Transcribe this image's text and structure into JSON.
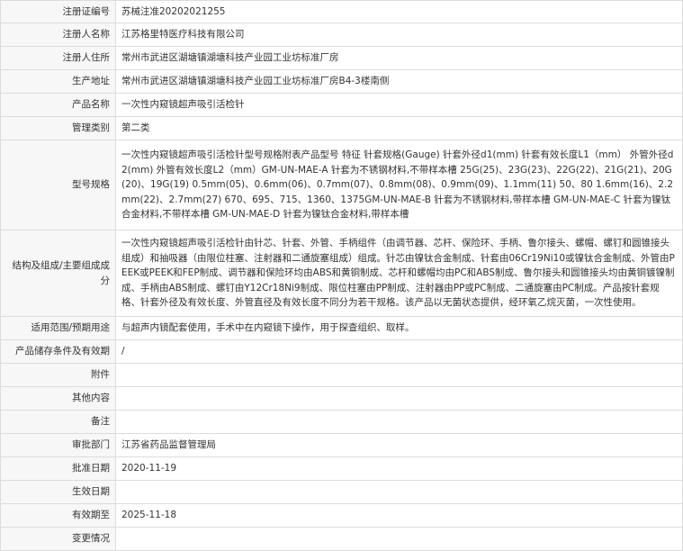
{
  "rows": [
    {
      "label": "注册证编号",
      "value": "苏械注准20202021255"
    },
    {
      "label": "注册人名称",
      "value": "江苏格里特医疗科技有限公司"
    },
    {
      "label": "注册人住所",
      "value": "常州市武进区湖塘镇湖塘科技产业园工业坊标准厂房"
    },
    {
      "label": "生产地址",
      "value": "常州市武进区湖塘镇湖塘科技产业园工业坊标准厂房B4-3楼南侧"
    },
    {
      "label": "产品名称",
      "value": "一次性内窥镜超声吸引活检针"
    },
    {
      "label": "管理类别",
      "value": "第二类"
    },
    {
      "label": "型号规格",
      "value": "一次性内窥镜超声吸引活检针型号规格附表产品型号 特征 针套规格(Gauge) 针套外径d1(mm) 针套有效长度L1（mm） 外管外径d2(mm) 外管有效长度L2（mm）GM-UN-MAE-A 针套为不锈钢材料,不带样本槽 25G(25)、23G(23)、22G(22)、21G(21)、20G(20)、19G(19) 0.5mm(05)、0.6mm(06)、0.7mm(07)、0.8mm(08)、0.9mm(09)、1.1mm(11) 50、80 1.6mm(16)、2.2mm(22)、2.7mm(27) 670、695、715、1360、1375GM-UN-MAE-B 针套为不锈钢材料,带样本槽 GM-UN-MAE-C 针套为镍钛合金材料,不带样本槽 GM-UN-MAE-D 针套为镍钛合金材料,带样本槽"
    },
    {
      "label": "结构及组成/主要组成成分",
      "value": "一次性内窥镜超声吸引活检针由针芯、针套、外管、手柄组件（由调节器、芯杆、保险环、手柄、鲁尔接头、螺帽、螺钉和圆锥接头组成）和抽吸器（由限位柱塞、注射器和二通旋塞组成）组成。针芯由镍钛合金制成、针套由06Cr19Ni10或镍钛合金制成、外管由PEEK或PEEK和FEP制成、调节器和保险环均由ABS和黄铜制成、芯杆和螺帽均由PC和ABS制成、鲁尔接头和圆锥接头均由黄铜镀镍制成、手柄由ABS制成、螺钉由Y12Cr18Ni9制成、限位柱塞由PP制成、注射器由PP或PC制成、二通旋塞由PC制成。产品按针套规格、针套外径及有效长度、外管直径及有效长度不同分为若干规格。该产品以无菌状态提供，经环氧乙烷灭菌，一次性使用。"
    },
    {
      "label": "适用范围/预期用途",
      "value": "与超声内镜配套使用，手术中在内窥镜下操作，用于探查组织、取样。"
    },
    {
      "label": "产品储存条件及有效期",
      "value": "/"
    },
    {
      "label": "附件",
      "value": ""
    },
    {
      "label": "其他内容",
      "value": ""
    },
    {
      "label": "备注",
      "value": ""
    },
    {
      "label": "审批部门",
      "value": "江苏省药品监督管理局"
    },
    {
      "label": "批准日期",
      "value": "2020-11-19"
    },
    {
      "label": "生效日期",
      "value": ""
    },
    {
      "label": "有效期至",
      "value": "2025-11-18"
    },
    {
      "label": "变更情况",
      "value": ""
    }
  ]
}
